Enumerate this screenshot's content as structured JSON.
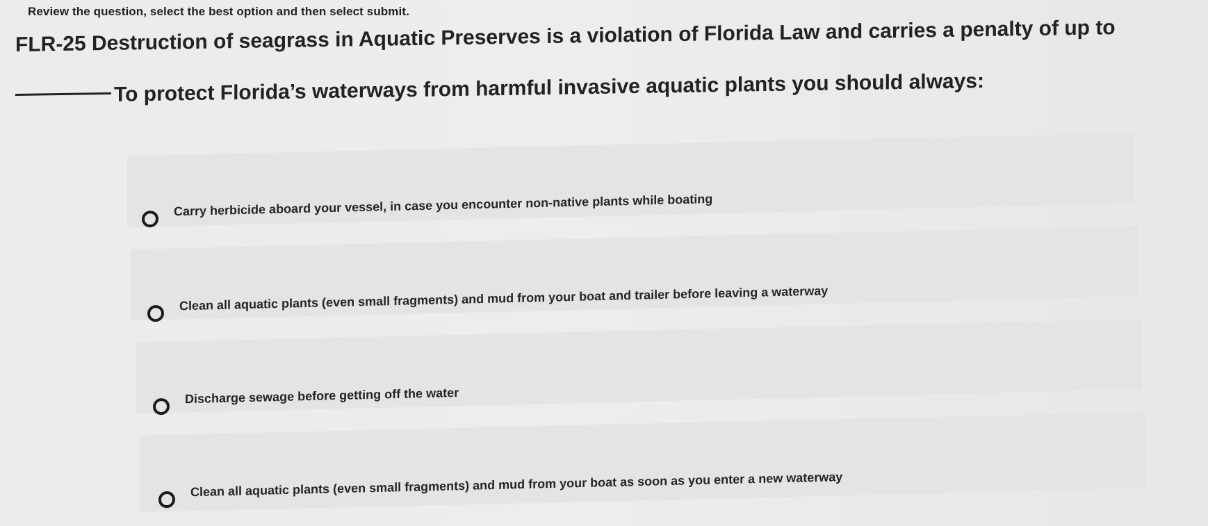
{
  "instructions": "Review the question, select the best option and then select submit.",
  "question": {
    "statement": "FLR-25 Destruction of seagrass in Aquatic Preserves is a violation of Florida Law and carries a penalty of up to",
    "prompt": "To protect Florida’s waterways from harmful invasive aquatic plants you should always:"
  },
  "options": [
    {
      "label": "Carry herbicide aboard your vessel, in case you encounter non-native plants while boating",
      "selected": false
    },
    {
      "label": "Clean all aquatic plants (even small fragments) and mud from your boat and trailer before leaving a waterway",
      "selected": false
    },
    {
      "label": "Discharge sewage before getting off the water",
      "selected": false
    },
    {
      "label": "Clean all aquatic plants (even small fragments) and mud from your boat as soon as you enter a new waterway",
      "selected": false
    }
  ]
}
